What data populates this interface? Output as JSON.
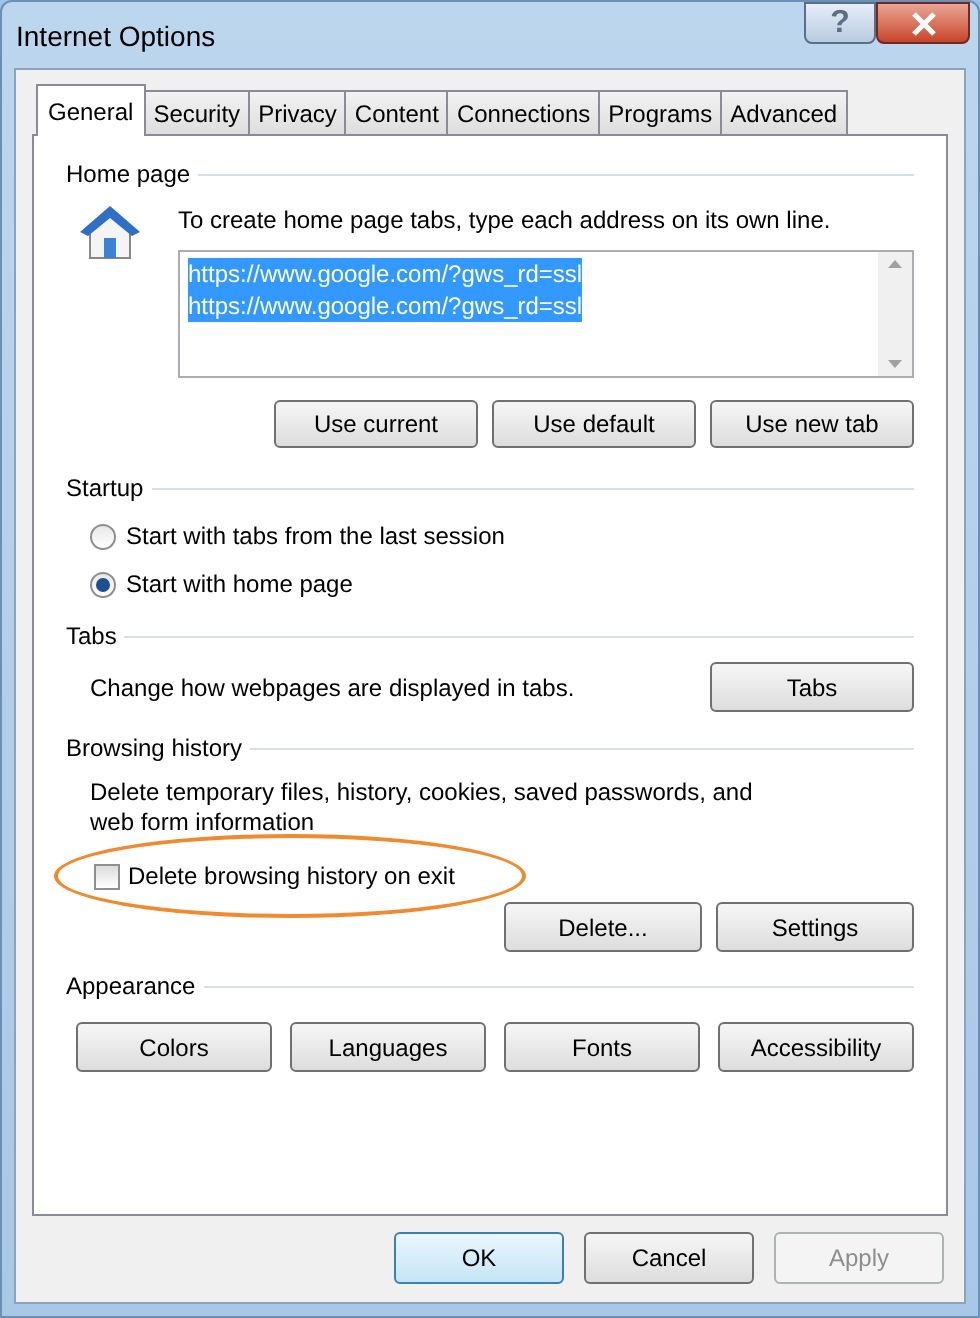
{
  "window": {
    "title": "Internet Options",
    "help": "?"
  },
  "tabs": [
    {
      "label": "General",
      "selected": true
    },
    {
      "label": "Security",
      "selected": false
    },
    {
      "label": "Privacy",
      "selected": false
    },
    {
      "label": "Content",
      "selected": false
    },
    {
      "label": "Connections",
      "selected": false
    },
    {
      "label": "Programs",
      "selected": false
    },
    {
      "label": "Advanced",
      "selected": false
    }
  ],
  "home_page": {
    "heading": "Home page",
    "instruction": "To create home page tabs, type each address on its own line.",
    "addresses": [
      "https://www.google.com/?gws_rd=ssl",
      "https://www.google.com/?gws_rd=ssl"
    ],
    "buttons": [
      "Use current",
      "Use default",
      "Use new tab"
    ]
  },
  "startup": {
    "heading": "Startup",
    "options": [
      {
        "label": "Start with tabs from the last session",
        "selected": false
      },
      {
        "label": "Start with home page",
        "selected": true
      }
    ]
  },
  "tabs_section": {
    "heading": "Tabs",
    "description": "Change how webpages are displayed in tabs.",
    "button": "Tabs"
  },
  "browsing_history": {
    "heading": "Browsing history",
    "description": "Delete temporary files, history, cookies, saved passwords, and web form information",
    "delete_on_exit": {
      "label": "Delete browsing history on exit",
      "checked": false
    },
    "buttons": [
      "Delete...",
      "Settings"
    ]
  },
  "appearance": {
    "heading": "Appearance",
    "buttons": [
      "Colors",
      "Languages",
      "Fonts",
      "Accessibility"
    ]
  },
  "footer_buttons": [
    {
      "label": "OK",
      "default": true,
      "disabled": false
    },
    {
      "label": "Cancel",
      "default": false,
      "disabled": false
    },
    {
      "label": "Apply",
      "default": false,
      "disabled": true
    }
  ]
}
